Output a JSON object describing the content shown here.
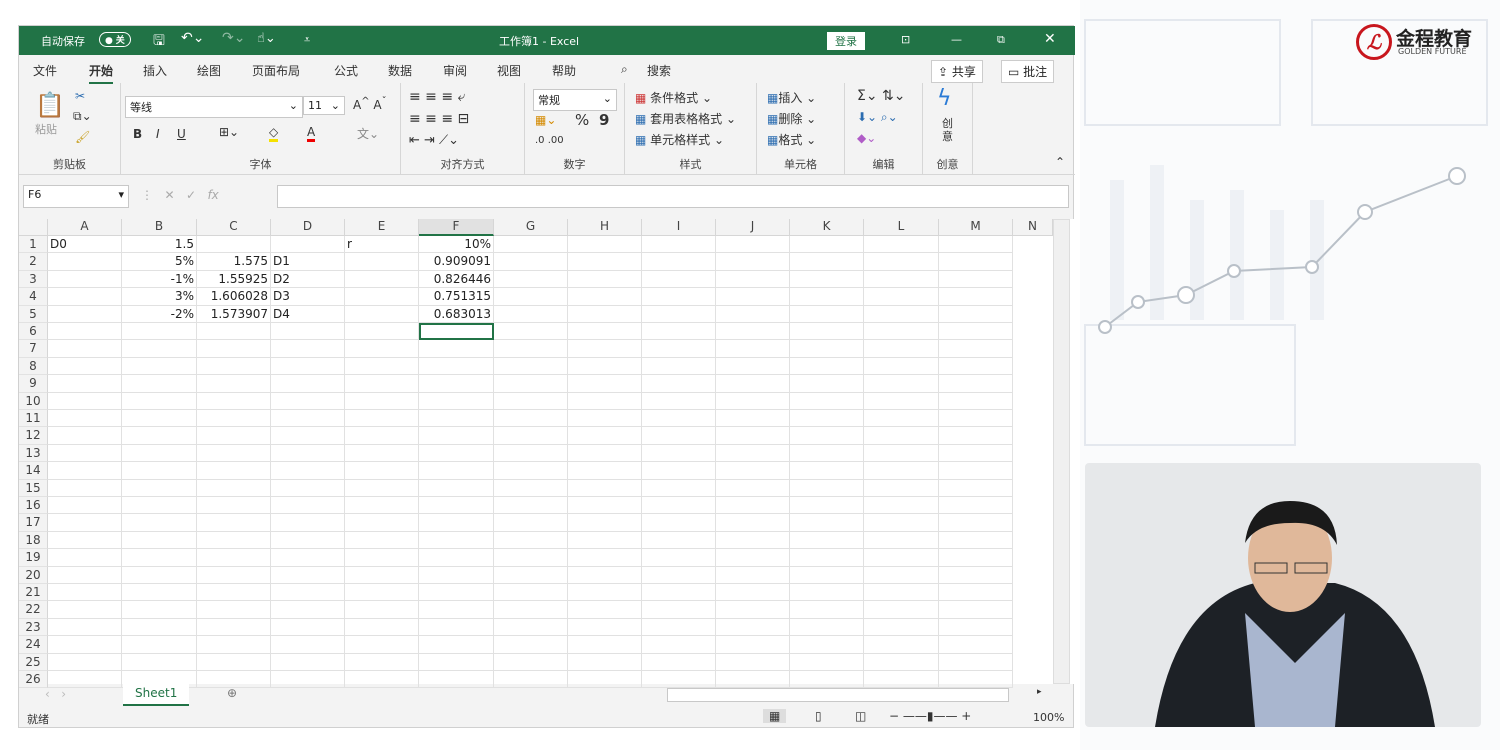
{
  "titlebar": {
    "autosave": "自动保存",
    "autosave_state": "关",
    "title": "工作簿1  -  Excel",
    "login": "登录"
  },
  "tabs": [
    "文件",
    "开始",
    "插入",
    "绘图",
    "页面布局",
    "公式",
    "数据",
    "审阅",
    "视图",
    "帮助"
  ],
  "search": "搜索",
  "share": "共享",
  "comment": "批注",
  "ribbon": {
    "clipboard": {
      "paste": "粘贴",
      "label": "剪贴板"
    },
    "font": {
      "name": "等线",
      "size": "11",
      "bold": "B",
      "italic": "I",
      "underline": "U",
      "label": "字体"
    },
    "alignment": {
      "label": "对齐方式"
    },
    "number": {
      "format": "常规",
      "percent": "%",
      "comma": "9",
      "label": "数字"
    },
    "styles": {
      "conditional": "条件格式",
      "table": "套用表格格式",
      "cell": "单元格样式",
      "label": "样式"
    },
    "cells": {
      "insert": "插入",
      "delete": "删除",
      "format": "格式",
      "label": "单元格"
    },
    "editing": {
      "label": "编辑"
    },
    "ideas": {
      "button": "创意",
      "label": "创意"
    }
  },
  "formula_bar": {
    "name_box": "F6",
    "value": ""
  },
  "columns": [
    "A",
    "B",
    "C",
    "D",
    "E",
    "F",
    "G",
    "H",
    "I",
    "J",
    "K",
    "L",
    "M",
    "N"
  ],
  "rows": [
    [
      "D0",
      "1.5",
      "",
      "",
      "r",
      "10%"
    ],
    [
      "",
      "5%",
      "1.575",
      "D1",
      "",
      "0.909091"
    ],
    [
      "",
      "-1%",
      "1.55925",
      "D2",
      "",
      "0.826446"
    ],
    [
      "",
      "3%",
      "1.606028",
      "D3",
      "",
      "0.751315"
    ],
    [
      "",
      "-2%",
      "1.573907",
      "D4",
      "",
      "0.683013"
    ]
  ],
  "row_count": 26,
  "selected_cell": "F6",
  "sheet_tab": "Sheet1",
  "status": {
    "ready": "就绪",
    "zoom": "100%"
  },
  "logo": {
    "cn": "金程教育",
    "en": "GOLDEN FUTURE"
  },
  "colors": {
    "excel_green": "#217346",
    "logo_red": "#c8161d"
  }
}
